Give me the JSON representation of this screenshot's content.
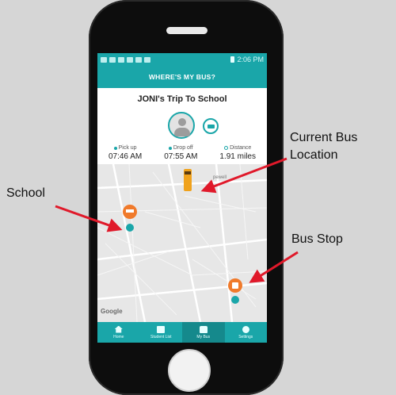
{
  "status_bar": {
    "time": "2:06 PM"
  },
  "app": {
    "header_title": "WHERE'S MY BUS?",
    "trip_title": "JONI's Trip To School"
  },
  "stats": [
    {
      "label": "Pick up",
      "value": "07:46 AM"
    },
    {
      "label": "Drop off",
      "value": "07:55 AM"
    },
    {
      "label": "Distance",
      "value": "1.91 miles"
    }
  ],
  "map": {
    "place_label": "pewell",
    "attribution": "Google"
  },
  "tabs": [
    {
      "label": "Home",
      "icon": "home-icon"
    },
    {
      "label": "Student List",
      "icon": "list-icon"
    },
    {
      "label": "My Bus",
      "icon": "bus-icon"
    },
    {
      "label": "Settings",
      "icon": "gear-icon"
    }
  ],
  "annotations": {
    "current_bus_location": "Current Bus Location",
    "school": "School",
    "bus_stop": "Bus Stop"
  },
  "colors": {
    "accent": "#1aa6a9",
    "marker": "#f07a2b",
    "arrow": "#e0192a"
  }
}
